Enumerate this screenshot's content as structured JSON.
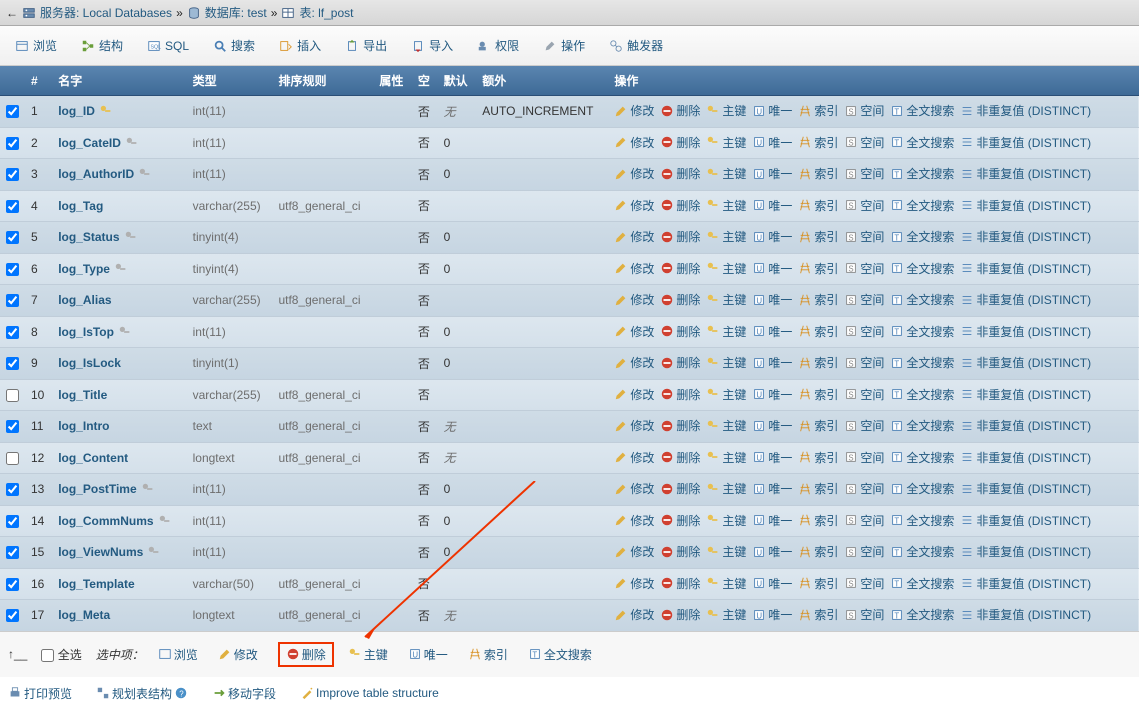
{
  "breadcrumb": {
    "back": "←",
    "serverLabel": "服务器: Local Databases",
    "dbLabel": "数据库: test",
    "tableLabel": "表: lf_post",
    "sep": "»"
  },
  "tabs": {
    "browse": "浏览",
    "structure": "结构",
    "sql": "SQL",
    "search": "搜索",
    "insert": "插入",
    "export": "导出",
    "import": "导入",
    "privs": "权限",
    "ops": "操作",
    "triggers": "触发器"
  },
  "thead": {
    "num": "#",
    "name": "名字",
    "type": "类型",
    "collation": "排序规则",
    "attr": "属性",
    "null": "空",
    "default": "默认",
    "extra": "额外",
    "action": "操作"
  },
  "actions": {
    "change": "修改",
    "drop": "删除",
    "primary": "主键",
    "unique": "唯一",
    "index": "索引",
    "spatial": "空间",
    "fulltext": "全文搜索",
    "distinct": "非重复值 (DISTINCT)"
  },
  "nullvals": {
    "no": "否",
    "none": "无"
  },
  "extras": {
    "ai": "AUTO_INCREMENT"
  },
  "rows": [
    {
      "n": 1,
      "checked": true,
      "name": "log_ID",
      "key": "pk",
      "type": "int(11)",
      "coll": "",
      "null": "no",
      "def": "none",
      "extra": "ai"
    },
    {
      "n": 2,
      "checked": true,
      "name": "log_CateID",
      "key": "idx",
      "type": "int(11)",
      "coll": "",
      "null": "no",
      "def": "0",
      "extra": ""
    },
    {
      "n": 3,
      "checked": true,
      "name": "log_AuthorID",
      "key": "idx",
      "type": "int(11)",
      "coll": "",
      "null": "no",
      "def": "0",
      "extra": ""
    },
    {
      "n": 4,
      "checked": true,
      "name": "log_Tag",
      "key": "",
      "type": "varchar(255)",
      "coll": "utf8_general_ci",
      "null": "no",
      "def": "",
      "extra": ""
    },
    {
      "n": 5,
      "checked": true,
      "name": "log_Status",
      "key": "idx",
      "type": "tinyint(4)",
      "coll": "",
      "null": "no",
      "def": "0",
      "extra": ""
    },
    {
      "n": 6,
      "checked": true,
      "name": "log_Type",
      "key": "idx",
      "type": "tinyint(4)",
      "coll": "",
      "null": "no",
      "def": "0",
      "extra": ""
    },
    {
      "n": 7,
      "checked": true,
      "name": "log_Alias",
      "key": "",
      "type": "varchar(255)",
      "coll": "utf8_general_ci",
      "null": "no",
      "def": "",
      "extra": ""
    },
    {
      "n": 8,
      "checked": true,
      "name": "log_IsTop",
      "key": "idx",
      "type": "int(11)",
      "coll": "",
      "null": "no",
      "def": "0",
      "extra": ""
    },
    {
      "n": 9,
      "checked": true,
      "name": "log_IsLock",
      "key": "",
      "type": "tinyint(1)",
      "coll": "",
      "null": "no",
      "def": "0",
      "extra": ""
    },
    {
      "n": 10,
      "checked": false,
      "name": "log_Title",
      "key": "",
      "type": "varchar(255)",
      "coll": "utf8_general_ci",
      "null": "no",
      "def": "",
      "extra": ""
    },
    {
      "n": 11,
      "checked": true,
      "name": "log_Intro",
      "key": "",
      "type": "text",
      "coll": "utf8_general_ci",
      "null": "no",
      "def": "none",
      "extra": ""
    },
    {
      "n": 12,
      "checked": false,
      "name": "log_Content",
      "key": "",
      "type": "longtext",
      "coll": "utf8_general_ci",
      "null": "no",
      "def": "none",
      "extra": ""
    },
    {
      "n": 13,
      "checked": true,
      "name": "log_PostTime",
      "key": "idx",
      "type": "int(11)",
      "coll": "",
      "null": "no",
      "def": "0",
      "extra": ""
    },
    {
      "n": 14,
      "checked": true,
      "name": "log_CommNums",
      "key": "idx",
      "type": "int(11)",
      "coll": "",
      "null": "no",
      "def": "0",
      "extra": ""
    },
    {
      "n": 15,
      "checked": true,
      "name": "log_ViewNums",
      "key": "idx",
      "type": "int(11)",
      "coll": "",
      "null": "no",
      "def": "0",
      "extra": ""
    },
    {
      "n": 16,
      "checked": true,
      "name": "log_Template",
      "key": "",
      "type": "varchar(50)",
      "coll": "utf8_general_ci",
      "null": "no",
      "def": "",
      "extra": ""
    },
    {
      "n": 17,
      "checked": true,
      "name": "log_Meta",
      "key": "",
      "type": "longtext",
      "coll": "utf8_general_ci",
      "null": "no",
      "def": "none",
      "extra": ""
    }
  ],
  "footer": {
    "checkAll": "全选",
    "withSelected": "选中项：",
    "browse": "浏览",
    "change": "修改",
    "drop": "删除",
    "primary": "主键",
    "unique": "唯一",
    "index": "索引",
    "fulltext": "全文搜索"
  },
  "footer2": {
    "print": "打印预览",
    "normalize": "规划表结构",
    "move": "移动字段",
    "improve": "Improve table structure"
  }
}
